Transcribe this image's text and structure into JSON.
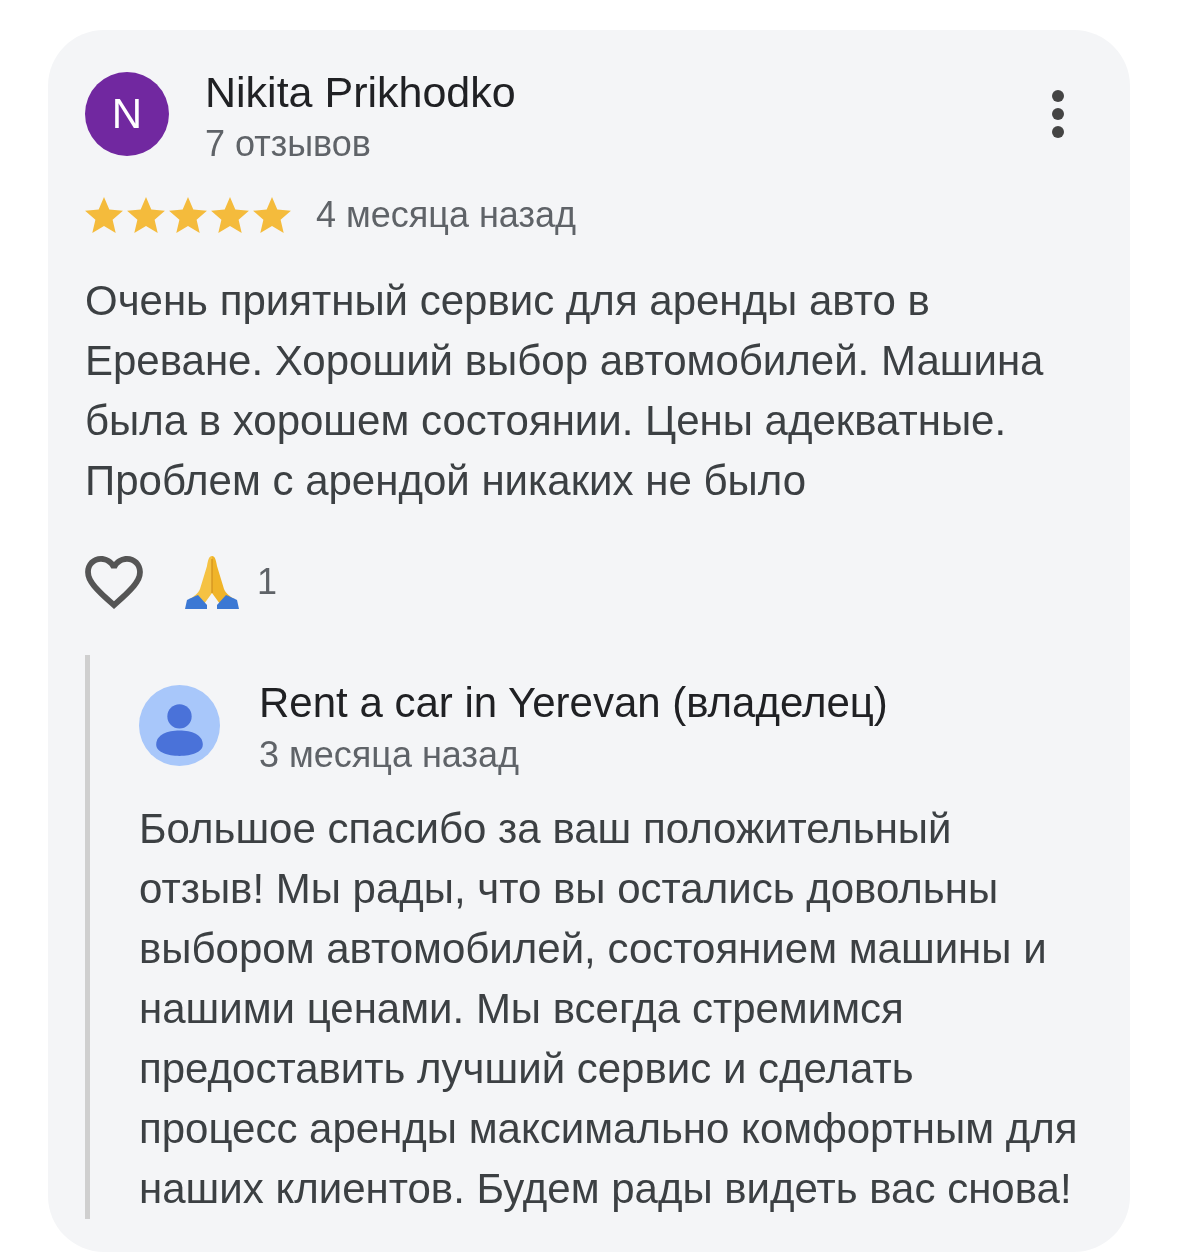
{
  "review": {
    "avatar_letter": "N",
    "author": "Nikita Prikhodko",
    "review_count": "7 отзывов",
    "stars": 5,
    "time": "4 месяца назад",
    "text": "Очень приятный сервис для аренды авто в\nЕреване. Хороший выбор автомобилей. Машина\nбыла в хорошем состоянии. Цены адекватные.\nПроблем с арендой никаких не было",
    "liked": false,
    "reactions": [
      {
        "kind": "pray",
        "count": "1"
      }
    ]
  },
  "reply": {
    "author": "Rent a car in Yerevan (владелец)",
    "time": "3 месяца назад",
    "text": "Большое спасибо за ваш положительный\nотзыв! Мы рады, что вы остались довольны\nвыбором автомобилей, состоянием машины и\nнашими ценами. Мы всегда стремимся\nпредоставить лучший сервис и сделать\nпроцесс аренды максимально комфортным для\nнаших клиентов. Будем рады видеть вас снова!"
  }
}
